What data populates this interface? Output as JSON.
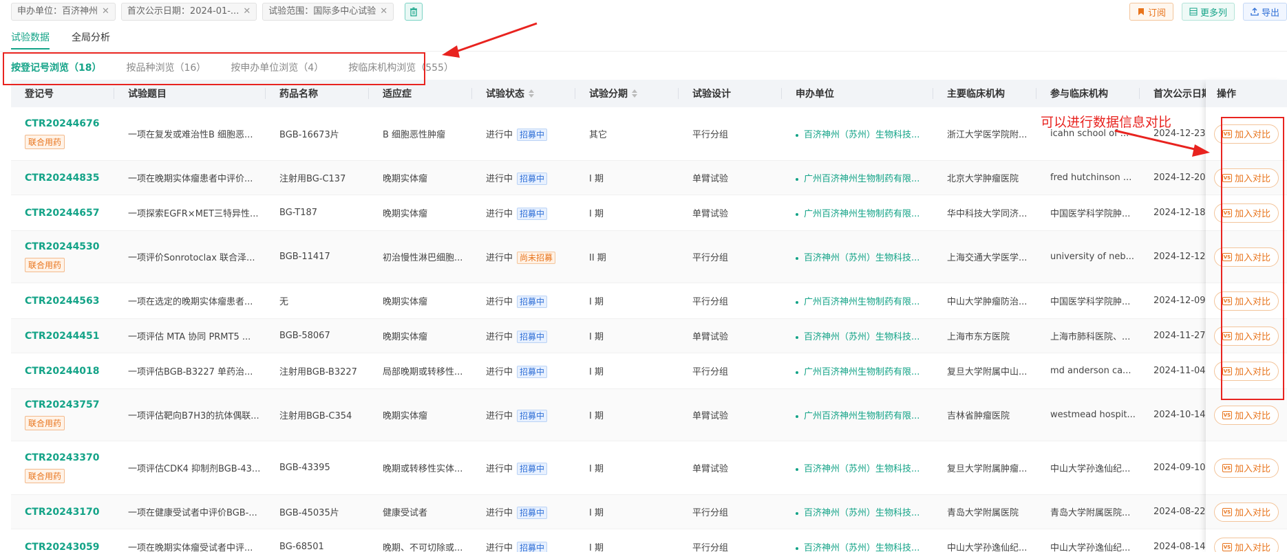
{
  "filters": [
    {
      "label": "申办单位：百济神州"
    },
    {
      "label": "首次公示日期：2024-01-..."
    },
    {
      "label": "试验范围：国际多中心试验"
    }
  ],
  "top_actions": {
    "subscribe": "订阅",
    "more_columns": "更多列",
    "export": "导出"
  },
  "main_tabs": [
    {
      "label": "试验数据",
      "active": true
    },
    {
      "label": "全局分析",
      "active": false
    }
  ],
  "browse_tabs": [
    {
      "label": "按登记号浏览（18）",
      "active": true
    },
    {
      "label": "按品种浏览（16）",
      "active": false
    },
    {
      "label": "按申办单位浏览（4）",
      "active": false
    },
    {
      "label": "按临床机构浏览（555）",
      "active": false
    }
  ],
  "annotation": "可以进行数据信息对比",
  "columns": [
    "登记号",
    "试验题目",
    "药品名称",
    "适应症",
    "试验状态",
    "试验分期",
    "试验设计",
    "申办单位",
    "主要临床机构",
    "参与临床机构",
    "首次公示日期",
    "操作"
  ],
  "compare_label": "加入对比",
  "combo_label": "联合用药",
  "rows": [
    {
      "reg": "CTR20244676",
      "combo": true,
      "title": "一项在复发或难治性B 细胞恶...",
      "drug": "BGB-16673片",
      "indication": "B 细胞恶性肿瘤",
      "status": "进行中",
      "recruit": "招募中",
      "recruit_color": "blue",
      "phase": "其它",
      "design": "平行分组",
      "sponsor": "百济神州（苏州）生物科技...",
      "main_site": "浙江大学医学院附...",
      "sites": "icahn school of ...",
      "date": "2024-12-23"
    },
    {
      "reg": "CTR20244835",
      "combo": false,
      "title": "一项在晚期实体瘤患者中评价...",
      "drug": "注射用BG-C137",
      "indication": "晚期实体瘤",
      "status": "进行中",
      "recruit": "招募中",
      "recruit_color": "blue",
      "phase": "I 期",
      "design": "单臂试验",
      "sponsor": "广州百济神州生物制药有限...",
      "main_site": "北京大学肿瘤医院",
      "sites": "fred hutchinson ...",
      "date": "2024-12-20"
    },
    {
      "reg": "CTR20244657",
      "combo": false,
      "title": "一项探索EGFR×MET三特异性...",
      "drug": "BG-T187",
      "indication": "晚期实体瘤",
      "status": "进行中",
      "recruit": "招募中",
      "recruit_color": "blue",
      "phase": "I 期",
      "design": "单臂试验",
      "sponsor": "广州百济神州生物制药有限...",
      "main_site": "华中科技大学同济...",
      "sites": "中国医学科学院肿...",
      "date": "2024-12-18"
    },
    {
      "reg": "CTR20244530",
      "combo": true,
      "title": "一项评价Sonrotoclax 联合泽...",
      "drug": "BGB-11417",
      "indication": "初治慢性淋巴细胞...",
      "status": "进行中",
      "recruit": "尚未招募",
      "recruit_color": "orange",
      "phase": "II 期",
      "design": "平行分组",
      "sponsor": "百济神州（苏州）生物科技...",
      "main_site": "上海交通大学医学...",
      "sites": "university of neb...",
      "date": "2024-12-12"
    },
    {
      "reg": "CTR20244563",
      "combo": false,
      "title": "一项在选定的晚期实体瘤患者...",
      "drug": "无",
      "indication": "晚期实体瘤",
      "status": "进行中",
      "recruit": "招募中",
      "recruit_color": "blue",
      "phase": "I 期",
      "design": "平行分组",
      "sponsor": "广州百济神州生物制药有限...",
      "main_site": "中山大学肿瘤防治...",
      "sites": "中国医学科学院肿...",
      "date": "2024-12-09"
    },
    {
      "reg": "CTR20244451",
      "combo": false,
      "title": "一项评估 MTA 协同 PRMT5 ...",
      "drug": "BGB-58067",
      "indication": "晚期实体瘤",
      "status": "进行中",
      "recruit": "招募中",
      "recruit_color": "blue",
      "phase": "I 期",
      "design": "单臂试验",
      "sponsor": "百济神州（苏州）生物科技...",
      "main_site": "上海市东方医院",
      "sites": "上海市肺科医院、...",
      "date": "2024-11-27"
    },
    {
      "reg": "CTR20244018",
      "combo": false,
      "title": "一项评估BGB-B3227 单药治...",
      "drug": "注射用BGB-B3227",
      "indication": "局部晚期或转移性...",
      "status": "进行中",
      "recruit": "招募中",
      "recruit_color": "blue",
      "phase": "I 期",
      "design": "平行分组",
      "sponsor": "广州百济神州生物制药有限...",
      "main_site": "复旦大学附属中山...",
      "sites": "md anderson ca...",
      "date": "2024-11-04"
    },
    {
      "reg": "CTR20243757",
      "combo": true,
      "title": "一项评估靶向B7H3的抗体偶联...",
      "drug": "注射用BGB-C354",
      "indication": "晚期实体瘤",
      "status": "进行中",
      "recruit": "招募中",
      "recruit_color": "blue",
      "phase": "I 期",
      "design": "单臂试验",
      "sponsor": "广州百济神州生物制药有限...",
      "main_site": "吉林省肿瘤医院",
      "sites": "westmead hospit...",
      "date": "2024-10-14"
    },
    {
      "reg": "CTR20243370",
      "combo": true,
      "title": "一项评估CDK4 抑制剂BGB-43...",
      "drug": "BGB-43395",
      "indication": "晚期或转移性实体...",
      "status": "进行中",
      "recruit": "招募中",
      "recruit_color": "blue",
      "phase": "I 期",
      "design": "单臂试验",
      "sponsor": "百济神州（苏州）生物科技...",
      "main_site": "复旦大学附属肿瘤...",
      "sites": "中山大学孙逸仙纪...",
      "date": "2024-09-10"
    },
    {
      "reg": "CTR20243170",
      "combo": false,
      "title": "一项在健康受试者中评价BGB-...",
      "drug": "BGB-45035片",
      "indication": "健康受试者",
      "status": "进行中",
      "recruit": "招募中",
      "recruit_color": "blue",
      "phase": "I 期",
      "design": "平行分组",
      "sponsor": "百济神州（苏州）生物科技...",
      "main_site": "青岛大学附属医院",
      "sites": "青岛大学附属医院...",
      "date": "2024-08-22"
    },
    {
      "reg": "CTR20243059",
      "combo": false,
      "title": "一项在晚期实体瘤受试者中评...",
      "drug": "BG-68501",
      "indication": "晚期、不可切除或...",
      "status": "进行中",
      "recruit": "招募中",
      "recruit_color": "blue",
      "phase": "I 期",
      "design": "平行分组",
      "sponsor": "百济神州（苏州）生物科技...",
      "main_site": "中山大学孙逸仙纪...",
      "sites": "中山大学孙逸仙纪...",
      "date": "2024-08-14"
    }
  ]
}
